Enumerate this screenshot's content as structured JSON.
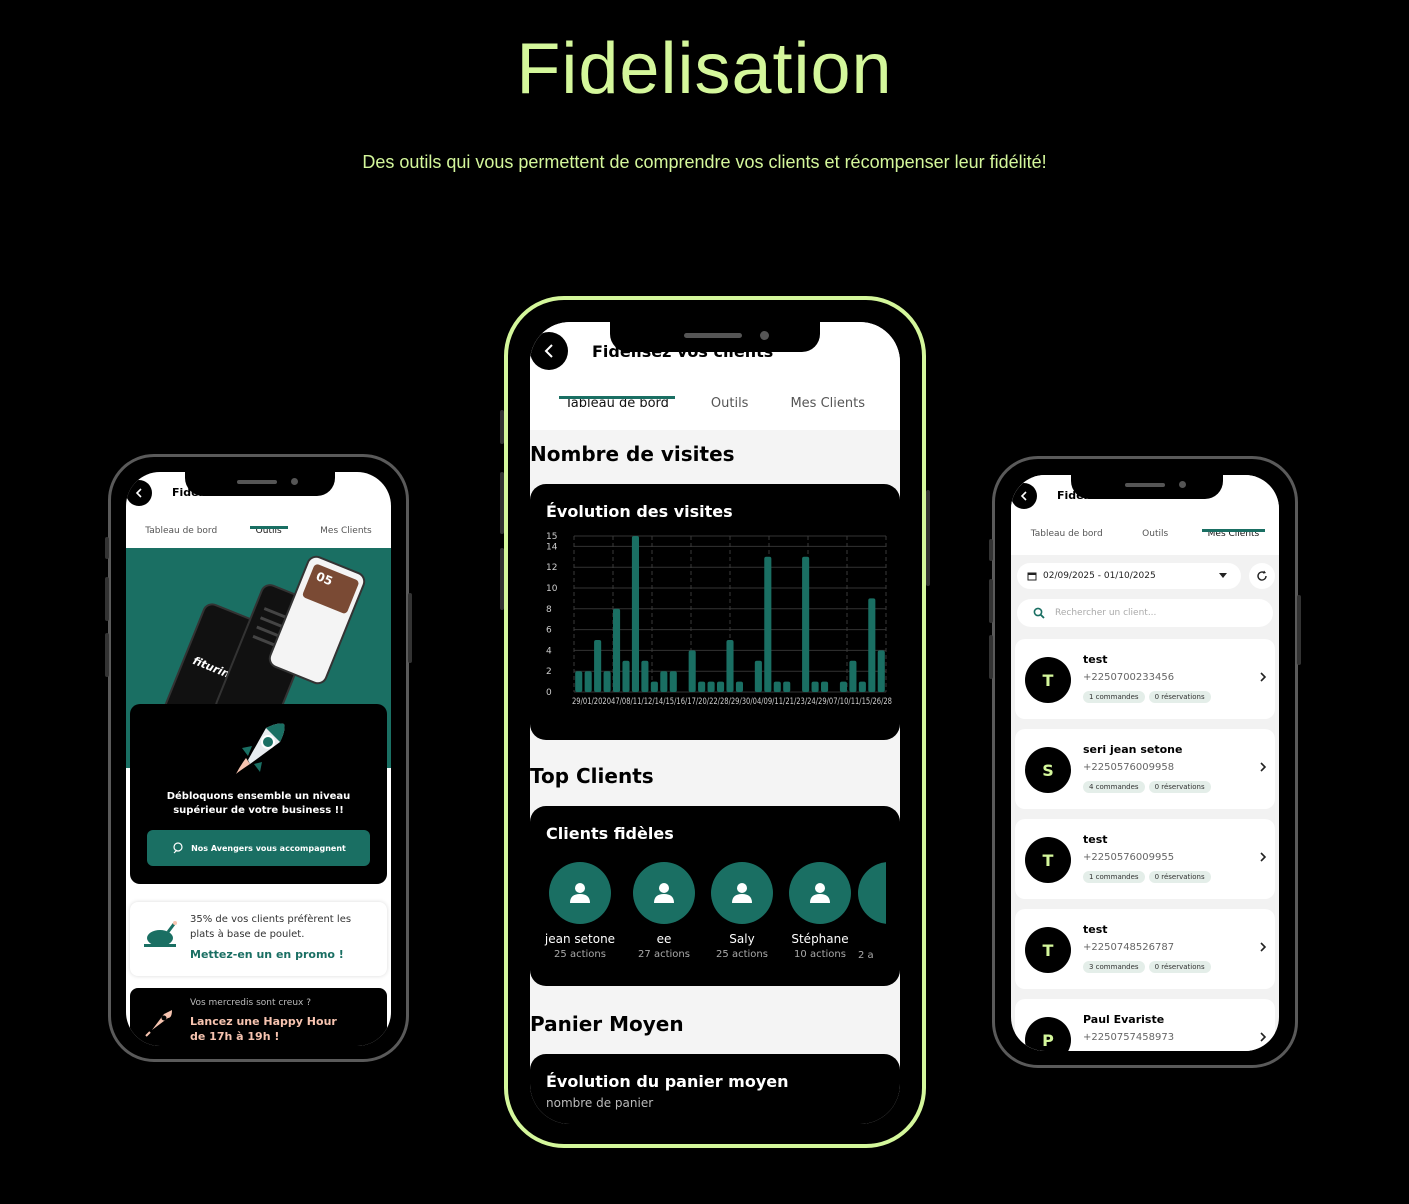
{
  "hero": {
    "title": "Fidelisation",
    "subtitle": "Des outils qui vous permettent de comprendre vos clients et récompenser leur fidélité!"
  },
  "app": {
    "title": "Fidelisez vos clients",
    "tabs": [
      "Tableau de bord",
      "Outils",
      "Mes Clients"
    ]
  },
  "left_phone": {
    "active_tab": "Outils",
    "banner_brand": "fituring",
    "banner_counter": "05",
    "avengers_text": "Débloquons ensemble un niveau supérieur de votre business !!",
    "avengers_button": "Nos Avengers vous accompagnent",
    "chicken_text": "35% de vos clients préfèrent les plats à base de poulet.",
    "chicken_cta": "Mettez-en un en promo !",
    "happy_small": "Vos mercredis sont creux ?",
    "happy_cta": "Lancez une Happy Hour de 17h à 19h !"
  },
  "center_phone": {
    "active_tab": "Tableau de bord",
    "visits_section": "Nombre de visites",
    "visits_card_title": "Évolution des visites",
    "top_clients_section": "Top Clients",
    "loyal_card_title": "Clients fidèles",
    "top_clients": [
      {
        "name": "jean setone",
        "actions": "25 actions"
      },
      {
        "name": "ee",
        "actions": "27 actions"
      },
      {
        "name": "Saly",
        "actions": "25 actions"
      },
      {
        "name": "Stéphane",
        "actions": "10 actions"
      },
      {
        "name": "",
        "actions": "2 a"
      }
    ],
    "basket_section": "Panier Moyen",
    "basket_card_title": "Évolution du panier moyen",
    "basket_card_subtitle": "nombre de panier"
  },
  "chart_data": {
    "type": "bar",
    "title": "Évolution des visites",
    "ylim": [
      0,
      15
    ],
    "yticks": [
      "0",
      "2",
      "4",
      "6",
      "8",
      "10",
      "12",
      "14",
      "15"
    ],
    "bar_color": "#1a6f63",
    "x_tick_label": "29/01/202047/08/11/12/14/15/16/17/20/22/28/29/30/04/09/11/21/23/24/29/07/10/11/15/26/28",
    "values": [
      2,
      2,
      5,
      2,
      8,
      3,
      15,
      3,
      1,
      2,
      2,
      0,
      4,
      1,
      1,
      1,
      5,
      1,
      0,
      3,
      13,
      1,
      1,
      0,
      13,
      1,
      1,
      0,
      1,
      3,
      1,
      9,
      4
    ]
  },
  "right_phone": {
    "active_tab": "Mes Clients",
    "date_range": "02/09/2025 - 01/10/2025",
    "search_placeholder": "Rechercher un client...",
    "clients": [
      {
        "initial": "T",
        "name": "test",
        "phone": "+2250700233456",
        "orders": "1 commandes",
        "reservations": "0 réservations"
      },
      {
        "initial": "S",
        "name": "seri jean setone",
        "phone": "+2250576009958",
        "orders": "4 commandes",
        "reservations": "0 réservations"
      },
      {
        "initial": "T",
        "name": "test",
        "phone": "+2250576009955",
        "orders": "1 commandes",
        "reservations": "0 réservations"
      },
      {
        "initial": "T",
        "name": "test",
        "phone": "+2250748526787",
        "orders": "3 commandes",
        "reservations": "0 réservations"
      },
      {
        "initial": "P",
        "name": "Paul Evariste",
        "phone": "+2250757458973",
        "orders": "",
        "reservations": ""
      }
    ]
  },
  "colors": {
    "accent_lime": "#d4f79b",
    "brand_green": "#1a6f63",
    "background": "#000000"
  }
}
